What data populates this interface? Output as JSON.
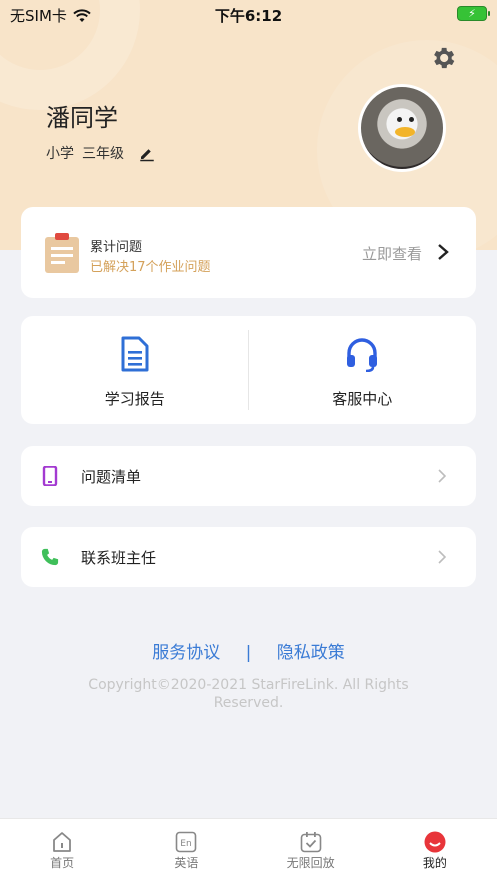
{
  "status_bar": {
    "carrier": "无SIM卡",
    "time": "下午6:12",
    "battery_symbol": "⚡",
    "wifi_icon": "wifi-icon"
  },
  "profile": {
    "name": "潘同学",
    "school_level": "小学",
    "grade": "三年级",
    "settings_icon": "gear-icon",
    "edit_icon": "pencil-icon"
  },
  "questions_card": {
    "title": "累计问题",
    "subtitle": "已解决17个作业问题",
    "link_label": "立即查看"
  },
  "quick_actions": [
    {
      "label": "学习报告",
      "icon": "document-icon"
    },
    {
      "label": "客服中心",
      "icon": "headset-icon"
    }
  ],
  "list_rows": [
    {
      "label": "问题清单",
      "icon": "phone-icon"
    },
    {
      "label": "联系班主任",
      "icon": "call-icon"
    }
  ],
  "footer": {
    "service_link": "服务协议",
    "separator": "|",
    "privacy_link": "隐私政策",
    "copyright": "Copyright©2020-2021 StarFireLink. All Rights Reserved."
  },
  "tabbar": {
    "items": [
      {
        "label": "首页",
        "icon": "home-icon"
      },
      {
        "label": "英语",
        "icon": "en-icon"
      },
      {
        "label": "无限回放",
        "icon": "calendar-check-icon"
      },
      {
        "label": "我的",
        "icon": "profile-face-icon"
      }
    ],
    "active_index": 3
  },
  "colors": {
    "hero": "#f8e4c9",
    "accent_blue": "#3a7bd5",
    "accent_gold": "#d4a15a",
    "purple": "#a33ad1",
    "green": "#3fbf5a",
    "tab_active": "#e8353a"
  }
}
